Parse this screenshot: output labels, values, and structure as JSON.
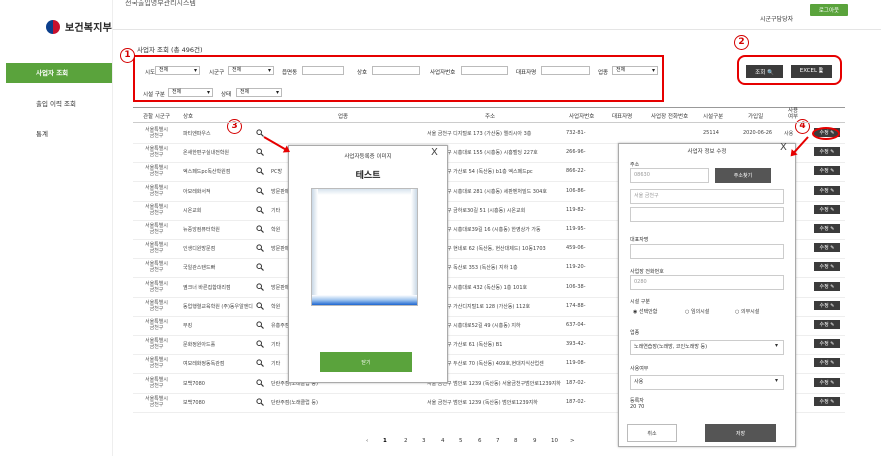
{
  "sidebar": {
    "logo_text": "보건복지부",
    "items": [
      {
        "label": "사업자 조회",
        "active": true
      },
      {
        "label": "출입 이력 조회",
        "active": false
      },
      {
        "label": "통계",
        "active": false
      }
    ]
  },
  "header": {
    "blurred_title": "전국출입명부관리시스템",
    "user_label": "시군구담당자",
    "logout_label": "로그아웃"
  },
  "page": {
    "title": "사업자 조회 (총 496건)"
  },
  "filters": {
    "sido_label": "시도",
    "sido_value": "전체",
    "sigungu_label": "시군구",
    "sigungu_value": "전체",
    "eupmyeondong_label": "읍면동",
    "shop_label": "상호",
    "bizno_label": "사업자번호",
    "ceo_label": "대표자명",
    "industry_label": "업종",
    "industry_value": "전체",
    "facility_label": "시설 구분",
    "facility_value": "전체",
    "status_label": "상태",
    "status_value": "전체",
    "search_button": "조회 🔍",
    "excel_button": "EXCEL 🖺"
  },
  "annotations": {
    "n1": "1",
    "n2": "2",
    "n3": "3",
    "n4": "4"
  },
  "table": {
    "headers": [
      "관할 시군구",
      "상호",
      "업종",
      "주소",
      "사업자번호",
      "대표자명",
      "사업장 전화번호",
      "시설구분",
      "가입일",
      "사용여부"
    ],
    "rows": [
      {
        "region": "서울특별시 금천구",
        "name": "파티엔파우스",
        "industry": "",
        "address": "서울 금천구 디지털로 173 (가산동) 엘리시아 3층",
        "bizno": "732-81-",
        "phone": "25114",
        "joined": "2020-06-26",
        "usage": "사용"
      },
      {
        "region": "서울특별시 금천구",
        "name": "온새한편구실내전학원",
        "industry": "",
        "address": "서울 금천구 시흥대로 155 (시흥동) 시흥벨딩 227호",
        "bizno": "266-96-",
        "phone": "",
        "joined": "",
        "usage": ""
      },
      {
        "region": "서울특별시 금천구",
        "name": "엑스페드pc독산학원점",
        "industry": "PC방",
        "address": "서울 금천구 가산로 54 (독산동) b1층 엑스페드pc",
        "bizno": "866-22-",
        "phone": "",
        "joined": "",
        "usage": ""
      },
      {
        "region": "서울특별시 금천구",
        "name": "아모레화서적",
        "industry": "방문판매업",
        "address": "서울 금천구 시흥대로 281 (시흥동) 세판벤처빌드 304호",
        "bizno": "106-86-",
        "phone": "",
        "joined": "",
        "usage": ""
      },
      {
        "region": "서울특별시 금천구",
        "name": "시온교회",
        "industry": "기타",
        "address": "서울 금천구 금하로30길 51 (시흥동) 시온교회",
        "bizno": "119-82-",
        "phone": "",
        "joined": "",
        "usage": ""
      },
      {
        "region": "서울특별시 금천구",
        "name": "뉴중앙컴퓨터학원",
        "industry": "학원",
        "address": "서울 금천구 시흥대로39길 16 (시흥동) 한영상가 가동",
        "bizno": "119-95-",
        "phone": "",
        "joined": "",
        "usage": ""
      },
      {
        "region": "서울특별시 금천구",
        "name": "인생디원방문점",
        "industry": "방문판매업",
        "address": "서울 금천구 현네로 62 (독산동, 현산대제드) 10동1703",
        "bizno": "459-06-",
        "phone": "",
        "joined": "",
        "usage": ""
      },
      {
        "region": "서울특별시 금천구",
        "name": "국일관스탠드빠",
        "industry": "",
        "address": "서울 금천구 독산로 353 (독산동) 지하 1층",
        "bizno": "119-20-",
        "phone": "",
        "joined": "",
        "usage": ""
      },
      {
        "region": "서울특별시 금천구",
        "name": "옆크너 바른집합대리점",
        "industry": "방문판매업",
        "address": "서울 금천구 시흥대로 432 (독산동) 1층 101호",
        "bizno": "106-38-",
        "phone": "",
        "joined": "",
        "usage": ""
      },
      {
        "region": "서울특별시 금천구",
        "name": "동업행렬교육학원 (주)동우알엔디",
        "industry": "학원",
        "address": "서울 금천구 가산디지털1로 128 (가산동) 112호",
        "bizno": "174-88-",
        "phone": "",
        "joined": "",
        "usage": ""
      },
      {
        "region": "서울특별시 금천구",
        "name": "무킹",
        "industry": "유흥주점",
        "address": "서울 금천구 시흥대로52길 49 (시흥동) 지하",
        "bizno": "637-04-",
        "phone": "",
        "joined": "",
        "usage": ""
      },
      {
        "region": "서울특별시 금천구",
        "name": "문화정원아드홀",
        "industry": "기타",
        "address": "서울 금천구 가산로 61 (독산동) B1",
        "bizno": "393-42-",
        "phone": "",
        "joined": "",
        "usage": ""
      },
      {
        "region": "서울특별시 금천구",
        "name": "여모레화정동독관점",
        "industry": "기타",
        "address": "서울 금천구 두산로 70 (독산동) 409호,현대지식산업센",
        "bizno": "119-08-",
        "phone": "",
        "joined": "",
        "usage": ""
      },
      {
        "region": "서울특별시 금천구",
        "name": "보백7080",
        "industry": "단란주점(노래클럽 등)",
        "address": "서울 금천구 범안로 1239 (독산동) 서울금천구범안로1239지하",
        "bizno": "187-02-",
        "phone": "",
        "joined": "",
        "usage": ""
      },
      {
        "region": "서울특별시 금천구",
        "name": "보백7080",
        "industry": "단란주점(노래클럽 등)",
        "address": "서울 금천구 범안로 1239 (독산동) 범안로1239지하",
        "bizno": "187-02-",
        "phone": "",
        "joined": "",
        "usage": ""
      }
    ],
    "edit_label": "수정 ✎"
  },
  "pagination": [
    "1",
    "2",
    "3",
    "4",
    "5",
    "6",
    "7",
    "8",
    "9",
    "10",
    ">"
  ],
  "modal_image": {
    "title": "사업자등록증 이미지",
    "close": "X",
    "content_title": "테스트",
    "close_button": "닫기"
  },
  "modal_edit": {
    "title": "사업자 정보 수정",
    "close": "X",
    "address_label": "주소",
    "zipcode": "08630",
    "find_address_button": "주소찾기",
    "address_line": "서울 금천구",
    "ceo_label": "대표자명",
    "phone_label": "사업장 전화번호",
    "phone_value": "0280",
    "facility_label": "시설 구분",
    "facility_options": [
      "선택안함",
      "임의시설",
      "의무시설"
    ],
    "industry_label": "업종",
    "industry_value": "노래연습장(노래방, 코인노래방 등)",
    "usage_label": "사용여부",
    "usage_value": "사용",
    "reg_date_label": "등록자",
    "reg_date_value": "20    70",
    "cancel_button": "취소",
    "save_button": "저장"
  }
}
